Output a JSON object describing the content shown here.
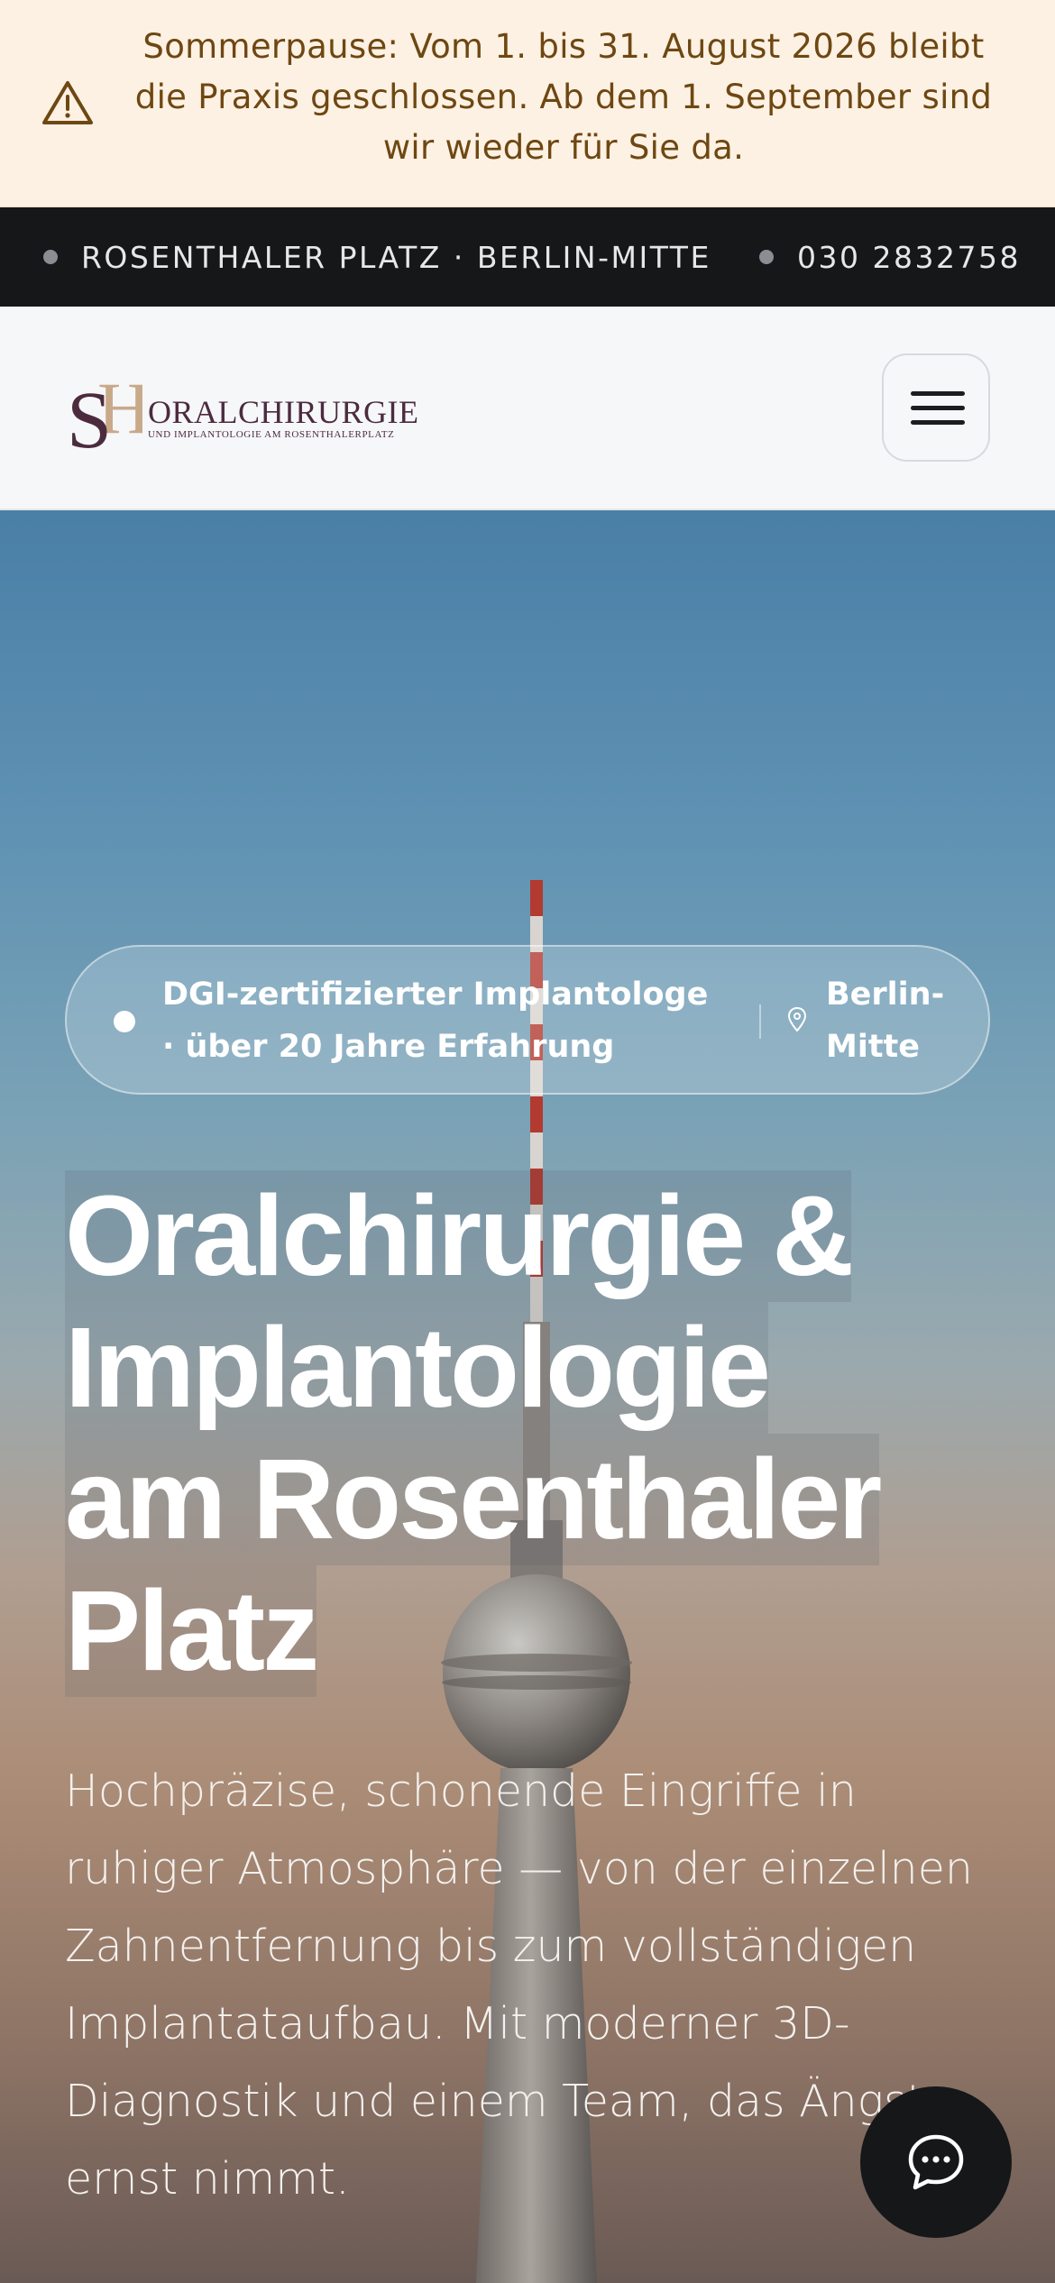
{
  "announcement": {
    "icon": "warning-icon",
    "text": "Sommerpause: Vom 1. bis 31. August 2026 bleibt die Praxis geschlossen. Ab dem 1. September sind wir wieder für Sie da.",
    "color": "#6e4712",
    "background": "#fdf1e3"
  },
  "topbar": {
    "location": "ROSENTHALER PLATZ · BERLIN-MITTE",
    "phone": "030 2832758"
  },
  "header": {
    "logo": {
      "monogram": "SH",
      "name": "ORALCHIRURGIE",
      "subtitle": "UND IMPLANTOLOGIE AM ROSENTHALERPLATZ"
    },
    "menu_icon": "hamburger-menu-icon"
  },
  "hero": {
    "badge": {
      "text": "DGI-zertifizierter Implantologe · über 20 Jahre Erfahrung",
      "location": "Berlin-Mitte",
      "location_icon": "map-pin-icon"
    },
    "headline_lines": [
      "Oralchirurgie &",
      "Implantologie",
      "am Rosenthaler",
      "Platz"
    ],
    "lead": "Hochpräzise, schonende Eingriffe in ruhiger Atmosphäre — von der einzelnen Zahnentfernung bis zum vollständigen Implantataufbau. Mit moderner 3D-Diagnostik und einem Team, das Ängste ernst nimmt.",
    "background_image": "Berlin TV tower"
  },
  "chat": {
    "icon": "chat-bubble-icon"
  },
  "colors": {
    "dark": "#151719",
    "brand": "#4c2b3f",
    "gold": "#c8a98a"
  }
}
